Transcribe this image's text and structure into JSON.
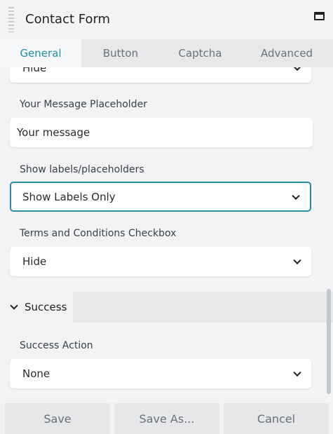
{
  "header": {
    "title": "Contact Form"
  },
  "tabs": [
    {
      "label": "General",
      "active": true
    },
    {
      "label": "Button",
      "active": false
    },
    {
      "label": "Captcha",
      "active": false
    },
    {
      "label": "Advanced",
      "active": false
    }
  ],
  "fields": {
    "top_partial_select": {
      "value": "Hide"
    },
    "message_placeholder": {
      "label": "Your Message Placeholder",
      "value": "Your message"
    },
    "show_labels": {
      "label": "Show labels/placeholders",
      "value": "Show Labels Only"
    },
    "terms_checkbox": {
      "label": "Terms and Conditions Checkbox",
      "value": "Hide"
    }
  },
  "success_section": {
    "title": "Success",
    "action": {
      "label": "Success Action",
      "value": "None"
    }
  },
  "footer": {
    "save_label": "Save",
    "save_as_label": "Save As...",
    "cancel_label": "Cancel"
  },
  "colors": {
    "accent": "#1b8fa6",
    "focus_border": "#2a8da8",
    "panel_bg": "#f2f3f4",
    "tab_bar_bg": "#e6e8ea"
  },
  "icons": [
    "drag-handle-icon",
    "maximize-icon",
    "chevron-down-icon"
  ]
}
